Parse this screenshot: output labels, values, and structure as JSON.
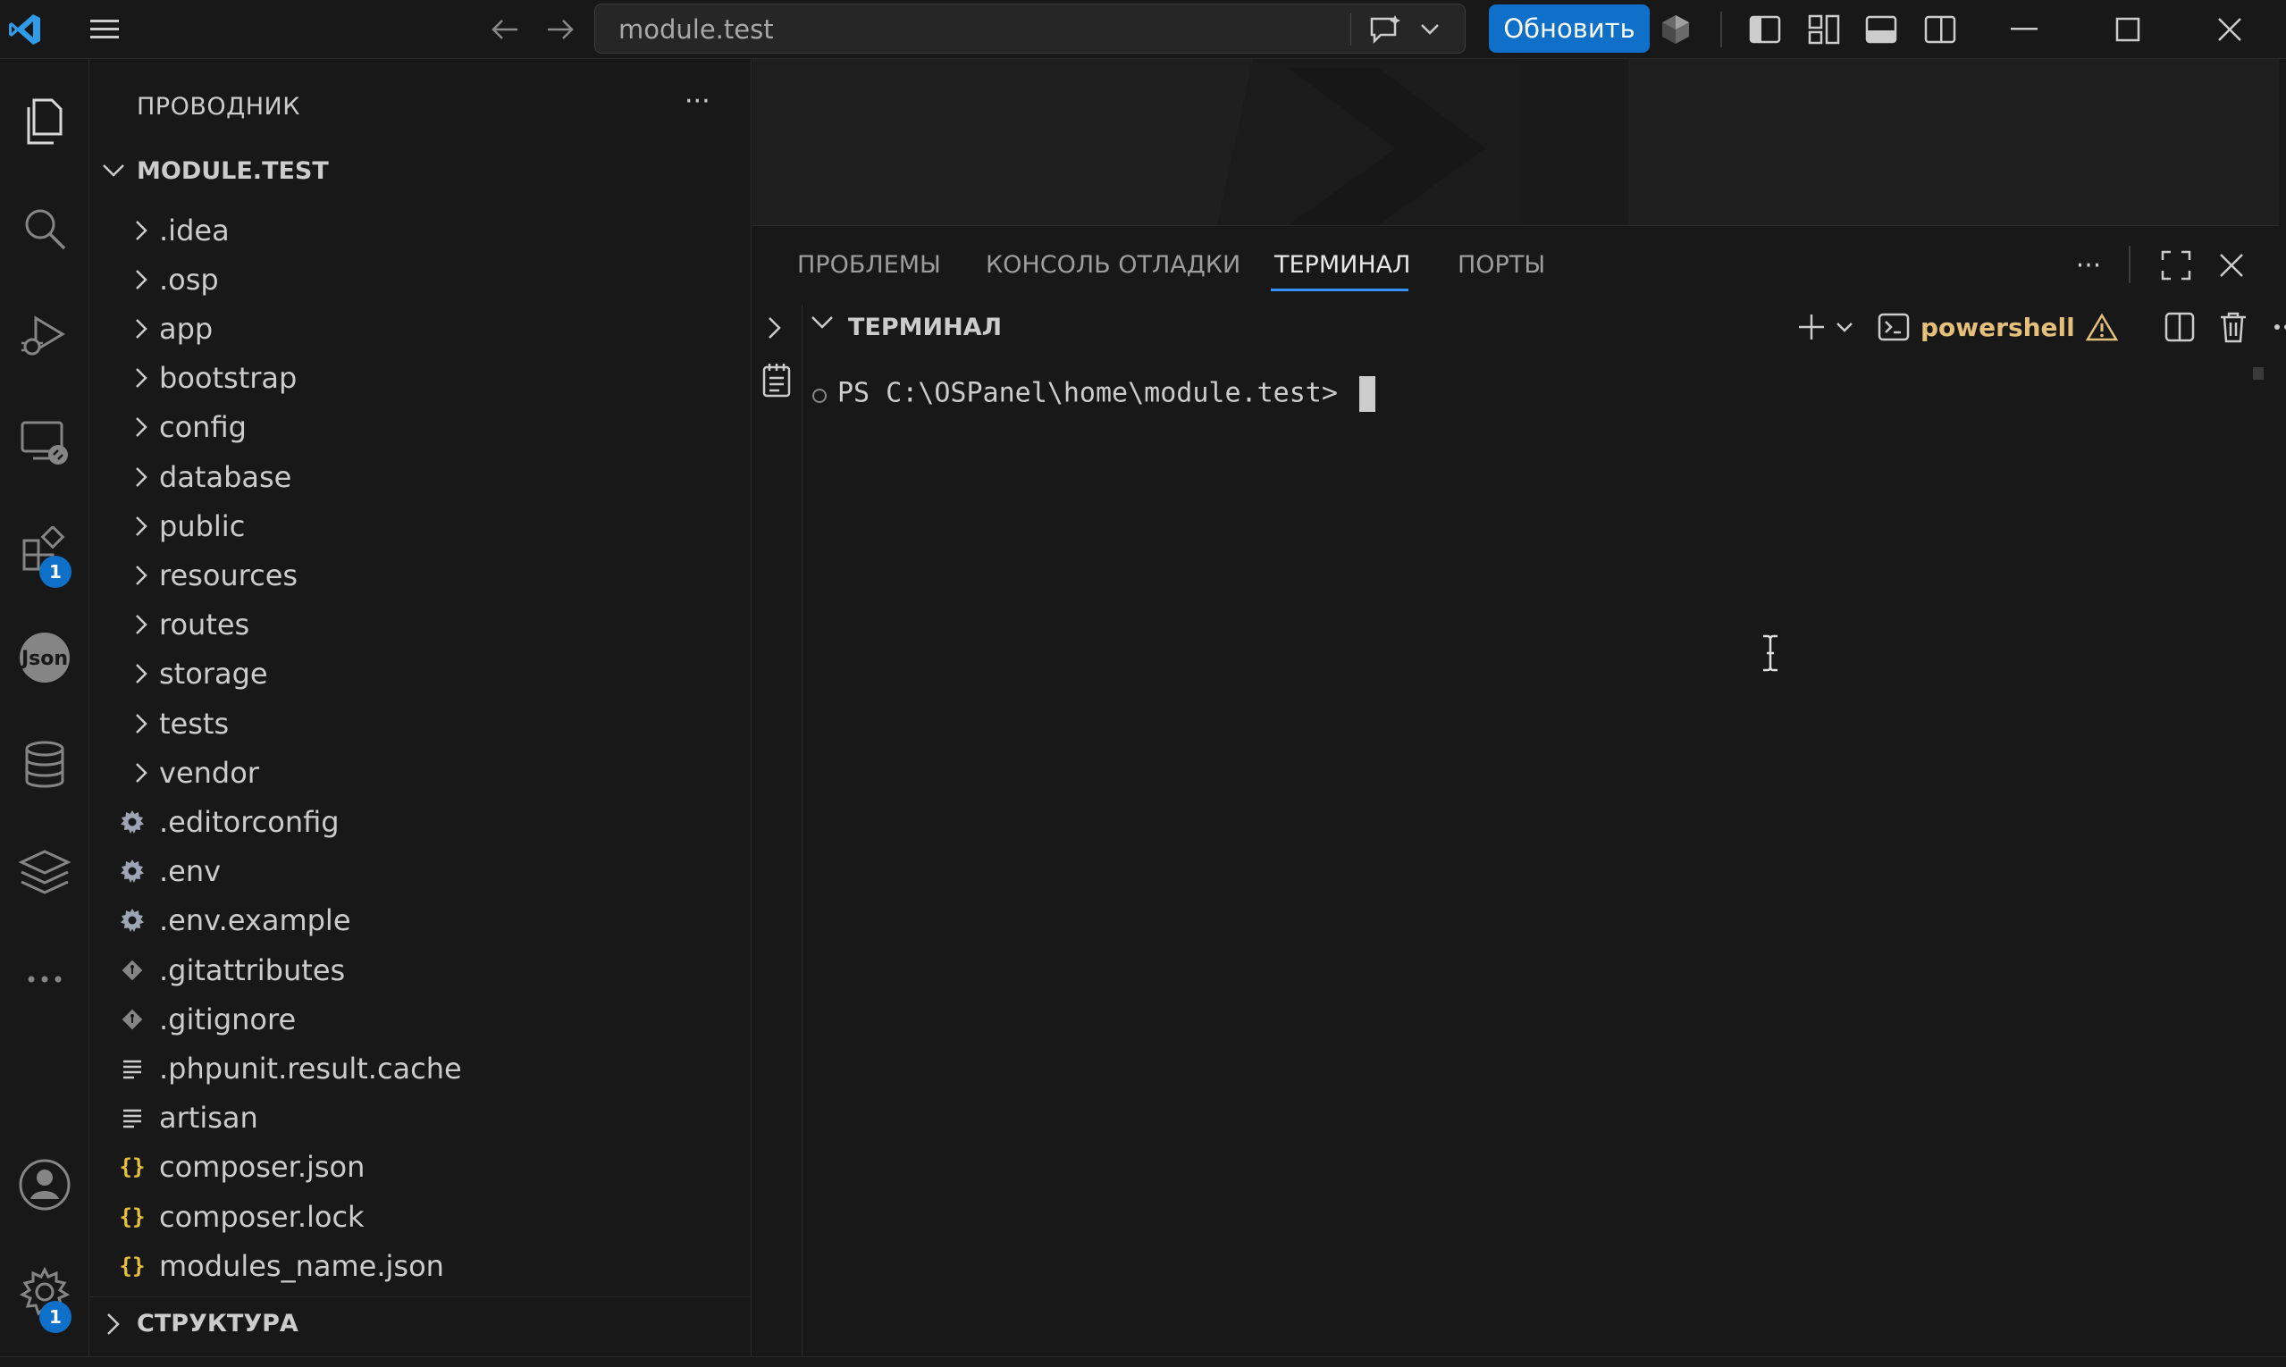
{
  "titlebar": {
    "search_text": "module.test",
    "update_label": "Обновить"
  },
  "activity_bar": {
    "extensions_badge": "1",
    "settings_badge": "1"
  },
  "sidebar": {
    "title": "ПРОВОДНИК",
    "more": "···",
    "root_label": "MODULE.TEST",
    "items": [
      {
        "name": ".idea",
        "type": "folder"
      },
      {
        "name": ".osp",
        "type": "folder"
      },
      {
        "name": "app",
        "type": "folder"
      },
      {
        "name": "bootstrap",
        "type": "folder"
      },
      {
        "name": "config",
        "type": "folder"
      },
      {
        "name": "database",
        "type": "folder"
      },
      {
        "name": "public",
        "type": "folder"
      },
      {
        "name": "resources",
        "type": "folder"
      },
      {
        "name": "routes",
        "type": "folder"
      },
      {
        "name": "storage",
        "type": "folder"
      },
      {
        "name": "tests",
        "type": "folder"
      },
      {
        "name": "vendor",
        "type": "folder"
      },
      {
        "name": ".editorconfig",
        "type": "gear"
      },
      {
        "name": ".env",
        "type": "gear"
      },
      {
        "name": ".env.example",
        "type": "gear"
      },
      {
        "name": ".gitattributes",
        "type": "git"
      },
      {
        "name": ".gitignore",
        "type": "git"
      },
      {
        "name": ".phpunit.result.cache",
        "type": "text"
      },
      {
        "name": "artisan",
        "type": "text"
      },
      {
        "name": "composer.json",
        "type": "json"
      },
      {
        "name": "composer.lock",
        "type": "json"
      },
      {
        "name": "modules_name.json",
        "type": "json"
      }
    ],
    "structure_label": "СТРУКТУРА"
  },
  "panel": {
    "tabs": [
      {
        "label": "ПРОБЛЕМЫ",
        "active": false
      },
      {
        "label": "КОНСОЛЬ ОТЛАДКИ",
        "active": false
      },
      {
        "label": "ТЕРМИНАЛ",
        "active": true
      },
      {
        "label": "ПОРТЫ",
        "active": false
      }
    ],
    "more": "···",
    "terminal_title": "ТЕРМИНАЛ",
    "shell_label": "powershell",
    "prompt": "PS C:\\OSPanel\\home\\module.test> "
  },
  "colors": {
    "accent": "#0e70c8",
    "json_icon": "#e8c33a",
    "warning": "#e5c07b",
    "tab_underline": "#3794ff"
  }
}
